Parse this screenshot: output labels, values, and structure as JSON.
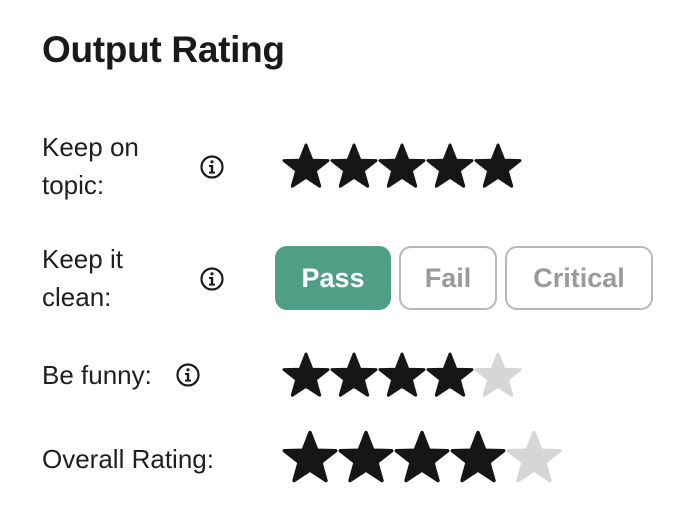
{
  "title": "Output Rating",
  "colors": {
    "star_filled": "#161616",
    "star_empty": "#d6d6d6",
    "pass_selected": "#519e87",
    "chip_border": "#b8b8b8",
    "chip_text": "#9a9a9a"
  },
  "criteria": [
    {
      "label": "Keep on topic:",
      "info_icon": "info-circle-icon",
      "type": "stars",
      "rating": 5,
      "max": 5
    },
    {
      "label": "Keep it clean:",
      "info_icon": "info-circle-icon",
      "type": "choice",
      "options": [
        "Pass",
        "Fail",
        "Critical"
      ],
      "selected": "Pass"
    },
    {
      "label": "Be funny:",
      "info_icon": "info-circle-icon",
      "type": "stars",
      "rating": 4,
      "max": 5
    }
  ],
  "overall": {
    "label": "Overall Rating:",
    "rating": 4,
    "max": 5
  }
}
